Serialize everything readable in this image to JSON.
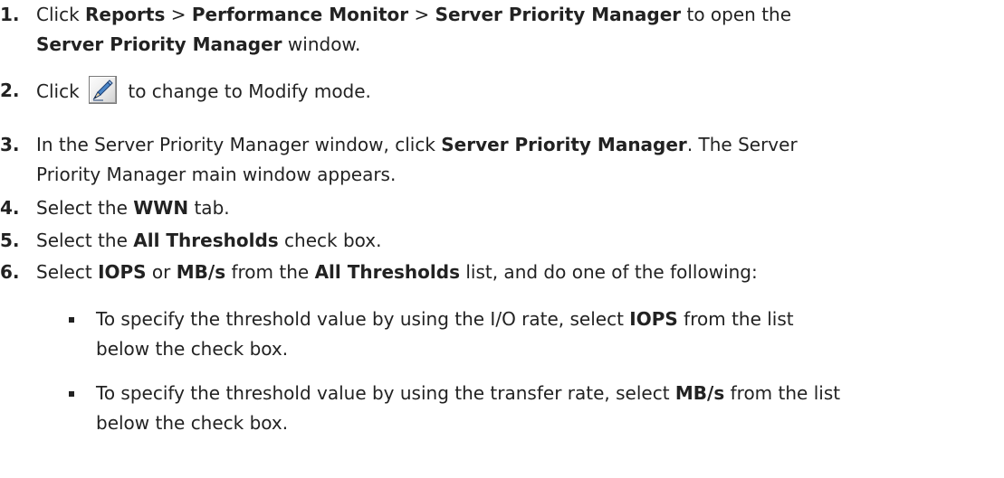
{
  "steps": [
    {
      "num": "1.",
      "parts": [
        {
          "t": "Click "
        },
        {
          "t": "Reports",
          "b": true
        },
        {
          "t": " > "
        },
        {
          "t": "Performance Monitor",
          "b": true
        },
        {
          "t": " > "
        },
        {
          "t": "Server Priority Manager",
          "b": true
        },
        {
          "t": " to open the "
        },
        {
          "br": true
        },
        {
          "t": "Server Priority Manager",
          "b": true
        },
        {
          "t": " window."
        }
      ]
    },
    {
      "num": "2.",
      "parts": [
        {
          "t": "Click "
        },
        {
          "icon": "modify-mode-pen-icon"
        },
        {
          "t": " to change to Modify mode."
        }
      ]
    },
    {
      "num": "3.",
      "parts": [
        {
          "t": "In the Server Priority Manager window, click "
        },
        {
          "t": "Server Priority Manager",
          "b": true
        },
        {
          "t": ". The Server "
        },
        {
          "br": true
        },
        {
          "t": "Priority Manager main window appears."
        }
      ]
    },
    {
      "num": "4.",
      "parts": [
        {
          "t": "Select the "
        },
        {
          "t": "WWN",
          "b": true
        },
        {
          "t": " tab."
        }
      ]
    },
    {
      "num": "5.",
      "parts": [
        {
          "t": "Select the "
        },
        {
          "t": "All Thresholds",
          "b": true
        },
        {
          "t": " check box."
        }
      ]
    },
    {
      "num": "6.",
      "parts": [
        {
          "t": "Select "
        },
        {
          "t": "IOPS",
          "b": true
        },
        {
          "t": " or "
        },
        {
          "t": "MB/s",
          "b": true
        },
        {
          "t": " from the "
        },
        {
          "t": "All Thresholds",
          "b": true
        },
        {
          "t": " list, and do one of the following:"
        }
      ]
    }
  ],
  "bullets": [
    {
      "parts": [
        {
          "t": "To specify the threshold value by using the I/O rate, select "
        },
        {
          "t": "IOPS",
          "b": true
        },
        {
          "t": " from the list "
        },
        {
          "br": true
        },
        {
          "t": "below the check box."
        }
      ]
    },
    {
      "parts": [
        {
          "t": "To specify the threshold value by using the transfer rate, select "
        },
        {
          "t": "MB/s",
          "b": true
        },
        {
          "t": " from the list "
        },
        {
          "br": true
        },
        {
          "t": "below the check box."
        }
      ]
    }
  ]
}
